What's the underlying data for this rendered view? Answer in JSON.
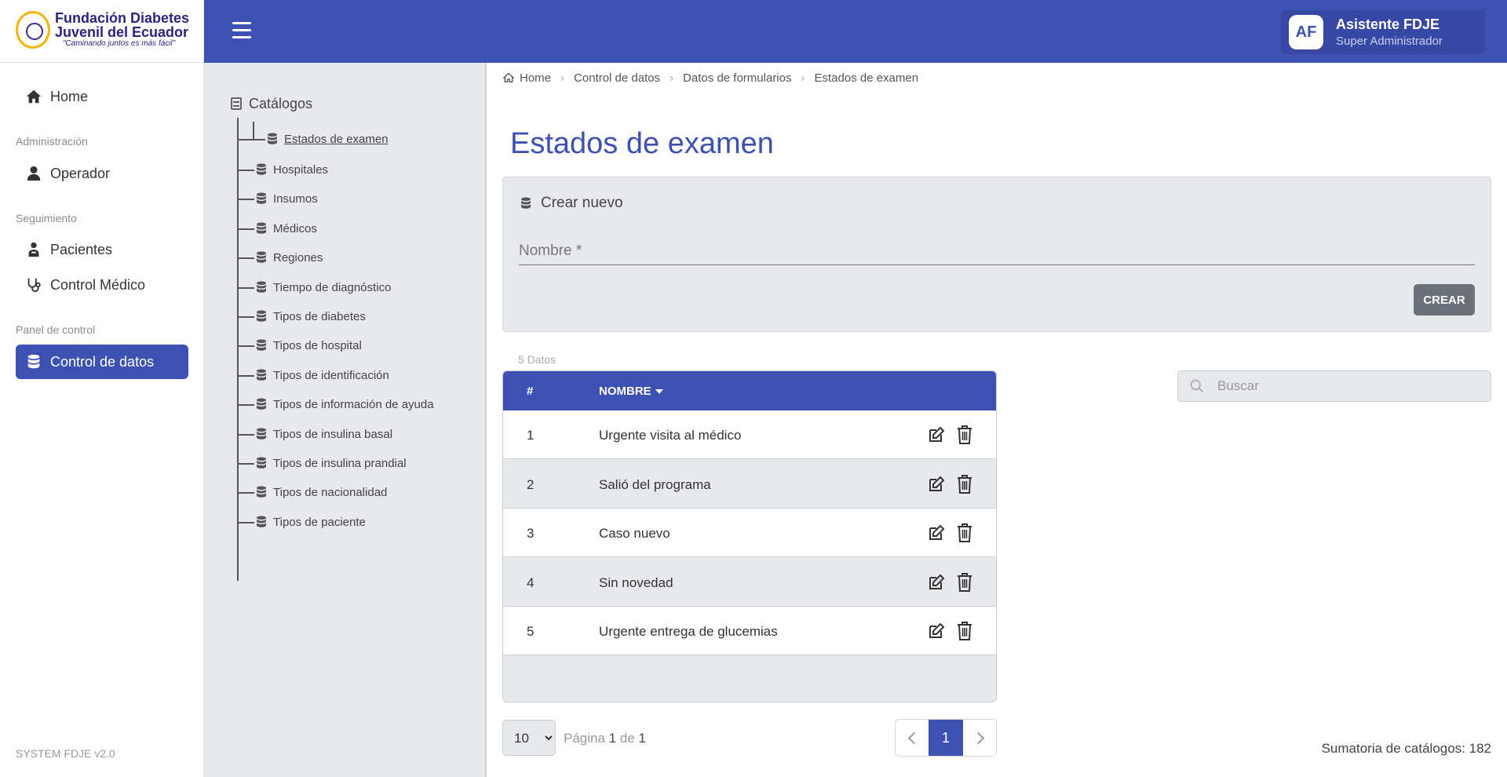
{
  "header": {
    "menu_icon": "hamburger-icon",
    "user": {
      "initials": "AF",
      "name": "Asistente FDJE",
      "role": "Super Administrador"
    }
  },
  "brand": {
    "line1": "Fundación Diabetes",
    "line2": "Juvenil del Ecuador",
    "tagline": "\"Caminando juntos es más fácil\""
  },
  "sidebar": {
    "home": "Home",
    "sections": {
      "admin": "Administración",
      "seguimiento": "Seguimiento",
      "panel": "Panel de control"
    },
    "items": {
      "operador": "Operador",
      "pacientes": "Pacientes",
      "control_medico": "Control Médico",
      "control_datos": "Control de datos"
    },
    "version": "SYSTEM FDJE v2.0"
  },
  "tree": {
    "root": "Catálogos",
    "nodes": [
      "Estados de examen",
      "Hospitales",
      "Insumos",
      "Médicos",
      "Regiones",
      "Tiempo de diagnóstico",
      "Tipos de diabetes",
      "Tipos de hospital",
      "Tipos de identificación",
      "Tipos de información de ayuda",
      "Tipos de insulina basal",
      "Tipos de insulina prandial",
      "Tipos de nacionalidad",
      "Tipos de paciente"
    ]
  },
  "breadcrumb": [
    "Home",
    "Control de datos",
    "Datos de formularios",
    "Estados de examen"
  ],
  "page": {
    "title": "Estados de examen"
  },
  "create_form": {
    "title": "Crear nuevo",
    "name_placeholder": "Nombre *",
    "name_value": "",
    "submit_label": "CREAR"
  },
  "table": {
    "count_label": "5 Datos",
    "search_placeholder": "Buscar",
    "headers": {
      "num": "#",
      "name": "NOMBRE"
    },
    "rows": [
      {
        "num": "1",
        "name": "Urgente visita al médico"
      },
      {
        "num": "2",
        "name": "Salió del programa"
      },
      {
        "num": "3",
        "name": "Caso nuevo"
      },
      {
        "num": "4",
        "name": "Sin novedad"
      },
      {
        "num": "5",
        "name": "Urgente entrega de glucemias"
      }
    ]
  },
  "pagination": {
    "page_size": "10",
    "page_label": "Página",
    "current": "1",
    "of_label": "de",
    "total": "1"
  },
  "summary": "Sumatoria de catálogos: 182",
  "colors": {
    "primary": "#3d51b3",
    "panel": "#e8e9ed",
    "button": "#6b7178"
  }
}
